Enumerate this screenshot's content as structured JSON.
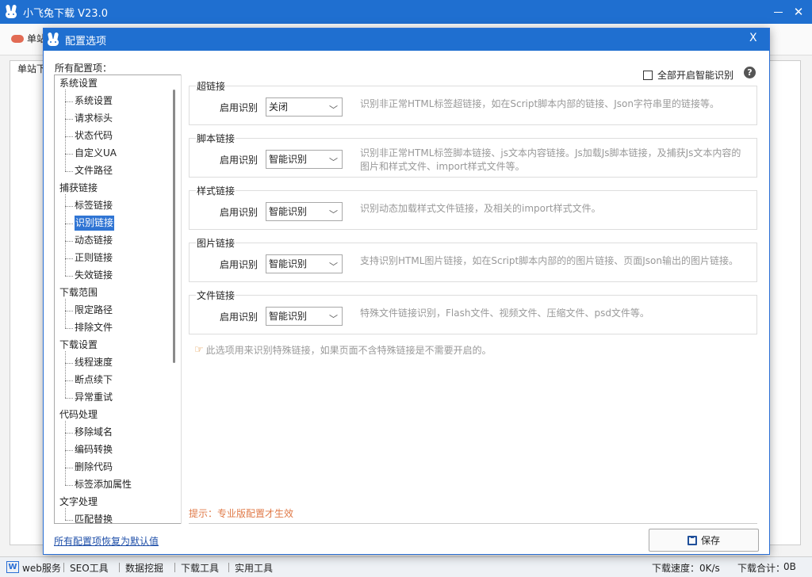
{
  "app": {
    "title": "小飞兔下载 V23.0"
  },
  "background": {
    "tab_label": "单站",
    "panel_label": "单站下",
    "status": {
      "badge": "W",
      "items": [
        "web服务",
        "SEO工具",
        "数据挖掘",
        "下载工具",
        "实用工具"
      ],
      "speed_label": "下载速度：0K/s",
      "total_label": "下载合计：",
      "total_value": "0B"
    }
  },
  "dialog": {
    "title": "配置选项",
    "close": "X",
    "tree_label": "所有配置项：",
    "tree": [
      {
        "label": "系统设置",
        "children": [
          "系统设置",
          "请求标头",
          "状态代码",
          "自定义UA",
          "文件路径"
        ]
      },
      {
        "label": "捕获链接",
        "children": [
          "标签链接",
          "识别链接",
          "动态链接",
          "正则链接",
          "失效链接"
        ]
      },
      {
        "label": "下载范围",
        "children": [
          "限定路径",
          "排除文件"
        ]
      },
      {
        "label": "下载设置",
        "children": [
          "线程速度",
          "断点续下",
          "异常重试"
        ]
      },
      {
        "label": "代码处理",
        "children": [
          "移除域名",
          "编码转换",
          "删除代码",
          "标签添加属性"
        ]
      },
      {
        "label": "文字处理",
        "children": [
          "匹配替换"
        ]
      }
    ],
    "selected_item": "识别链接",
    "smart_all_label": "全部开启智能识别",
    "help": "?",
    "groups": [
      {
        "title": "超链接",
        "row_label": "启用识别",
        "value": "关闭",
        "desc": "识别非正常HTML标签超链接，如在Script脚本内部的链接、Json字符串里的链接等。"
      },
      {
        "title": "脚本链接",
        "row_label": "启用识别",
        "value": "智能识别",
        "desc": "识别非正常HTML标签脚本链接、js文本内容链接。Js加载Js脚本链接，及捕获Js文本内容的图片和样式文件、import样式文件等。"
      },
      {
        "title": "样式链接",
        "row_label": "启用识别",
        "value": "智能识别",
        "desc": "识别动态加载样式文件链接，及相关的import样式文件。"
      },
      {
        "title": "图片链接",
        "row_label": "启用识别",
        "value": "智能识别",
        "desc": "支持识别HTML图片链接，如在Script脚本内部的的图片链接、页面Json输出的图片链接。"
      },
      {
        "title": "文件链接",
        "row_label": "启用识别",
        "value": "智能识别",
        "desc": "特殊文件链接识别，Flash文件、视频文件、压缩文件、psd文件等。"
      }
    ],
    "note": "此选项用来识别特殊链接，如果页面不含特殊链接是不需要开启的。",
    "tip": "提示：专业版配置才生效",
    "reset_link": "所有配置项恢复为默认值",
    "save_label": "保存"
  }
}
